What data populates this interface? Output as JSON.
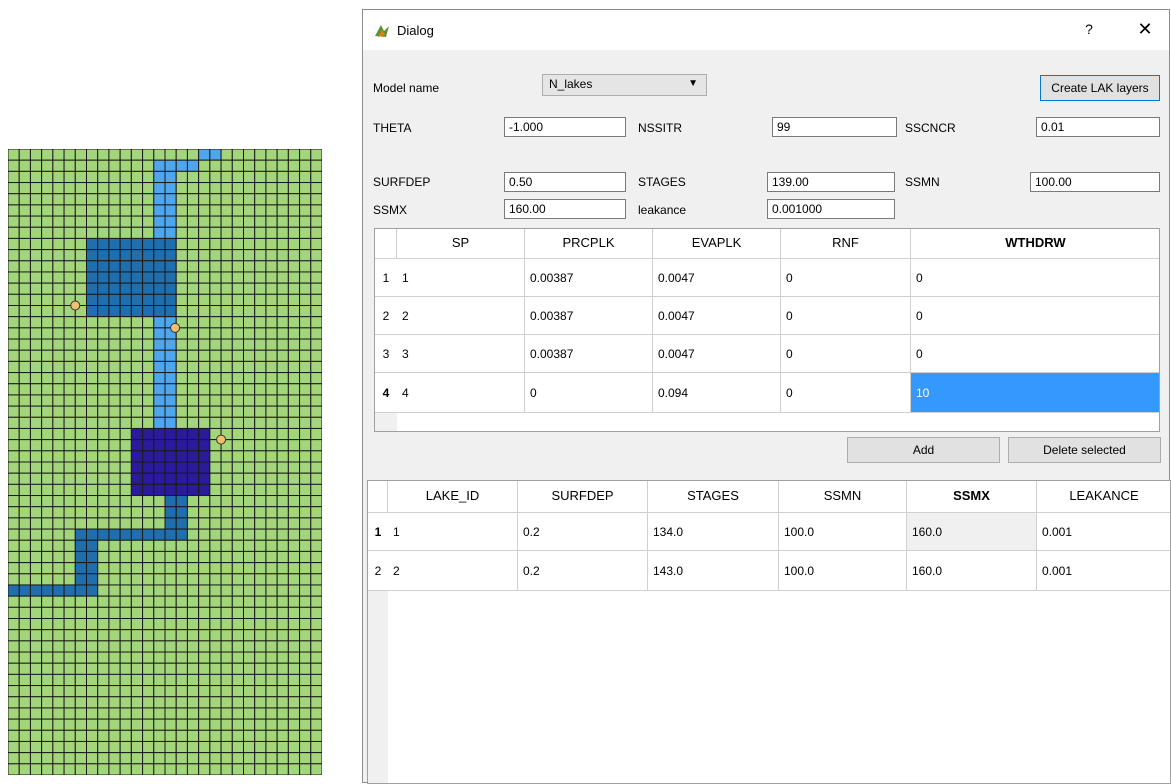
{
  "dialog": {
    "title": "Dialog",
    "help_label": "?",
    "close_label": "✕"
  },
  "form": {
    "model_name_label": "Model name",
    "model_name_value": "N_lakes",
    "create_button": "Create LAK layers",
    "theta_label": "THETA",
    "theta_value": "-1.000",
    "nssitr_label": "NSSITR",
    "nssitr_value": "99",
    "sscncr_label": "SSCNCR",
    "sscncr_value": "0.01",
    "surfdep_label": "SURFDEP",
    "surfdep_value": "0.50",
    "stages_label": "STAGES",
    "stages_value": "139.00",
    "ssmn_label": "SSMN",
    "ssmn_value": "100.00",
    "ssmx_label": "SSMX",
    "ssmx_value": "160.00",
    "leakance_label": "leakance",
    "leakance_value": "0.001000"
  },
  "sp_table": {
    "headers": [
      "SP",
      "PRCPLK",
      "EVAPLK",
      "RNF",
      "WTHDRW"
    ],
    "row_numbers": [
      "1",
      "2",
      "3",
      "4"
    ],
    "rows": [
      [
        "1",
        "0.00387",
        "0.0047",
        "0",
        "0"
      ],
      [
        "2",
        "0.00387",
        "0.0047",
        "0",
        "0"
      ],
      [
        "3",
        "0.00387",
        "0.0047",
        "0",
        "0"
      ],
      [
        "4",
        "0",
        "0.094",
        "0",
        "10"
      ]
    ]
  },
  "buttons": {
    "add": "Add",
    "delete_selected": "Delete selected"
  },
  "lake_table": {
    "headers": [
      "LAKE_ID",
      "SURFDEP",
      "STAGES",
      "SSMN",
      "SSMX",
      "LEAKANCE"
    ],
    "row_numbers": [
      "1",
      "2"
    ],
    "rows": [
      [
        "1",
        "0.2",
        "134.0",
        "100.0",
        "160.0",
        "0.001"
      ],
      [
        "2",
        "0.2",
        "143.0",
        "100.0",
        "160.0",
        "0.001"
      ]
    ]
  },
  "map_colors": {
    "land": "#a3d67a",
    "river": "#4ea6ee",
    "lake1": "#1f6fae",
    "lake2": "#2a1b9e",
    "outlet": "#1f6fae",
    "gridline": "#1a1a1a",
    "marker": "#f0c070"
  }
}
